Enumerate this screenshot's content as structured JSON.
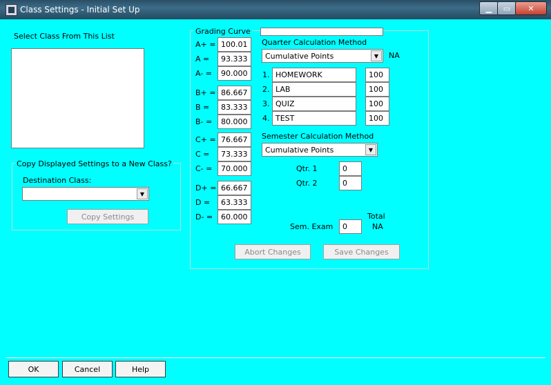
{
  "window": {
    "title": "Class Settings - Initial Set Up",
    "minimize": "▁",
    "maximize": "▭",
    "close": "✕"
  },
  "left": {
    "list_label": "Select Class From This List",
    "copy_group_label": "Copy Displayed Settings to a New Class?",
    "dest_label": "Destination Class:",
    "dest_value": "",
    "copy_button": "Copy Settings"
  },
  "grading": {
    "label": "Grading Curve",
    "title_field": "",
    "grades": [
      {
        "label": "A+ =",
        "value": "100.01"
      },
      {
        "label": "A  =",
        "value": "93.333"
      },
      {
        "label": "A- =",
        "value": "90.000"
      },
      {
        "label": "B+ =",
        "value": "86.667"
      },
      {
        "label": "B  =",
        "value": "83.333"
      },
      {
        "label": "B- =",
        "value": "80.000"
      },
      {
        "label": "C+ =",
        "value": "76.667"
      },
      {
        "label": "C  =",
        "value": "73.333"
      },
      {
        "label": "C- =",
        "value": "70.000"
      },
      {
        "label": "D+ =",
        "value": "66.667"
      },
      {
        "label": "D  =",
        "value": "63.333"
      },
      {
        "label": "D- =",
        "value": "60.000"
      }
    ]
  },
  "quarter": {
    "label": "Quarter Calculation Method",
    "method": "Cumulative Points",
    "na": "NA",
    "categories": [
      {
        "num": "1.",
        "name": "HOMEWORK",
        "weight": "100"
      },
      {
        "num": "2.",
        "name": "LAB",
        "weight": "100"
      },
      {
        "num": "3.",
        "name": "QUIZ",
        "weight": "100"
      },
      {
        "num": "4.",
        "name": "TEST",
        "weight": "100"
      }
    ]
  },
  "semester": {
    "label": "Semester Calculation Method",
    "method": "Cumulative Points",
    "qtr1_label": "Qtr. 1",
    "qtr1": "0",
    "qtr2_label": "Qtr. 2",
    "qtr2": "0",
    "total_label": "Total",
    "exam_label": "Sem. Exam",
    "exam": "0",
    "total_value": "NA"
  },
  "actions": {
    "abort": "Abort Changes",
    "save": "Save Changes"
  },
  "footer": {
    "ok": "OK",
    "cancel": "Cancel",
    "help": "Help"
  }
}
